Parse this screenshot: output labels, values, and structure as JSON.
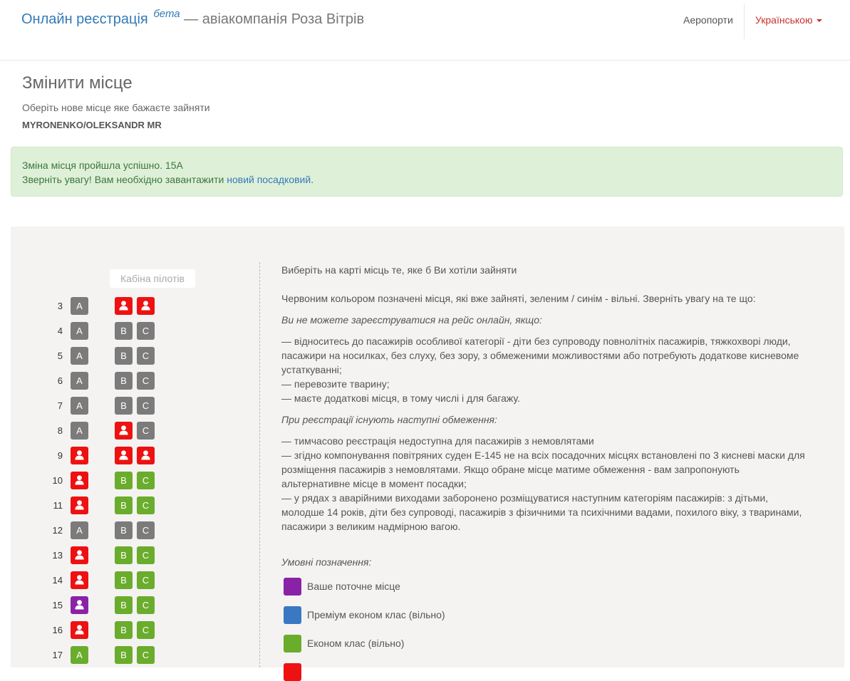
{
  "header": {
    "brand_main": "Онлайн реєстрація",
    "brand_beta": "бета",
    "brand_rest": "— авіакомпанія Роза Вітрів",
    "nav_airports": "Аеропорти",
    "nav_language": "Українською"
  },
  "page": {
    "title": "Змінити місце",
    "subtitle": "Оберіть нове місце яке бажаєте зайняти",
    "passenger": "MYRONENKO/OLEKSANDR MR"
  },
  "alert": {
    "line1": "Зміна місця пройшла успішно. 15A",
    "line2_prefix": "Зверніть увагу! Вам необхідно завантажити ",
    "line2_link": "новий посадковий",
    "line2_suffix": "."
  },
  "seatmap": {
    "cabin_label": "Кабіна пілотів",
    "colors": {
      "gray": "#7b7b7b",
      "green": "#6aac2c",
      "red": "#ee1111",
      "purple": "#8a22a8",
      "blue": "#3a78c3"
    },
    "rows": [
      {
        "row": "3",
        "seats": [
          {
            "letter": "A",
            "status": "unavailable"
          },
          {
            "letter": "B",
            "status": "occupied"
          },
          {
            "letter": "C",
            "status": "occupied"
          }
        ]
      },
      {
        "row": "4",
        "seats": [
          {
            "letter": "A",
            "status": "unavailable"
          },
          {
            "letter": "B",
            "status": "unavailable"
          },
          {
            "letter": "C",
            "status": "unavailable"
          }
        ]
      },
      {
        "row": "5",
        "seats": [
          {
            "letter": "A",
            "status": "unavailable"
          },
          {
            "letter": "B",
            "status": "unavailable"
          },
          {
            "letter": "C",
            "status": "unavailable"
          }
        ]
      },
      {
        "row": "6",
        "seats": [
          {
            "letter": "A",
            "status": "unavailable"
          },
          {
            "letter": "B",
            "status": "unavailable"
          },
          {
            "letter": "C",
            "status": "unavailable"
          }
        ]
      },
      {
        "row": "7",
        "seats": [
          {
            "letter": "A",
            "status": "unavailable"
          },
          {
            "letter": "B",
            "status": "unavailable"
          },
          {
            "letter": "C",
            "status": "unavailable"
          }
        ]
      },
      {
        "row": "8",
        "seats": [
          {
            "letter": "A",
            "status": "unavailable"
          },
          {
            "letter": "B",
            "status": "occupied"
          },
          {
            "letter": "C",
            "status": "unavailable"
          }
        ]
      },
      {
        "row": "9",
        "seats": [
          {
            "letter": "A",
            "status": "occupied"
          },
          {
            "letter": "B",
            "status": "occupied"
          },
          {
            "letter": "C",
            "status": "occupied"
          }
        ]
      },
      {
        "row": "10",
        "seats": [
          {
            "letter": "A",
            "status": "occupied"
          },
          {
            "letter": "B",
            "status": "free"
          },
          {
            "letter": "C",
            "status": "free"
          }
        ]
      },
      {
        "row": "11",
        "seats": [
          {
            "letter": "A",
            "status": "occupied"
          },
          {
            "letter": "B",
            "status": "free"
          },
          {
            "letter": "C",
            "status": "free"
          }
        ]
      },
      {
        "row": "12",
        "seats": [
          {
            "letter": "A",
            "status": "unavailable"
          },
          {
            "letter": "B",
            "status": "unavailable"
          },
          {
            "letter": "C",
            "status": "unavailable"
          }
        ]
      },
      {
        "row": "13",
        "seats": [
          {
            "letter": "A",
            "status": "occupied"
          },
          {
            "letter": "B",
            "status": "free"
          },
          {
            "letter": "C",
            "status": "free"
          }
        ]
      },
      {
        "row": "14",
        "seats": [
          {
            "letter": "A",
            "status": "occupied"
          },
          {
            "letter": "B",
            "status": "free"
          },
          {
            "letter": "C",
            "status": "free"
          }
        ]
      },
      {
        "row": "15",
        "seats": [
          {
            "letter": "A",
            "status": "current"
          },
          {
            "letter": "B",
            "status": "free"
          },
          {
            "letter": "C",
            "status": "free"
          }
        ]
      },
      {
        "row": "16",
        "seats": [
          {
            "letter": "A",
            "status": "occupied"
          },
          {
            "letter": "B",
            "status": "free"
          },
          {
            "letter": "C",
            "status": "free"
          }
        ]
      },
      {
        "row": "17",
        "seats": [
          {
            "letter": "A",
            "status": "free"
          },
          {
            "letter": "B",
            "status": "free"
          },
          {
            "letter": "C",
            "status": "free"
          }
        ]
      }
    ]
  },
  "info": {
    "intro": "Виберіть на карті місць те, яке б Ви хотіли зайняти",
    "color_note": "Червоним кольором позначені місця, які вже зайняті, зеленим / синім - вільні. Зверніть увагу на те що:",
    "cannot_heading": "Ви не можете зареєструватися на рейс онлайн, якщо:",
    "cannot_1a": "— відноситесь до пасажирів особливої категорії - діти без супроводу повнолітніх пасажирів, тяжкохворі люди,",
    "cannot_1b": "пасажири на носилках, без слуху, без зору, з обмеженими можливостями або потребують додаткове кисневоме",
    "cannot_1c": "устаткуванні;",
    "cannot_2": "— перевозите тварину;",
    "cannot_3": "— маєте додаткові місця, в тому числі і для багажу.",
    "limits_heading": "При реєстрації існують наступні обмеження:",
    "limit_1": "— тимчасово реєстрація недоступна для пасажирів з немовлятами",
    "limit_2a": "— згідно компонування повітряних суден Е-145 не на всіх посадочних місцях встановлені по 3 кисневі маски для",
    "limit_2b": "розміщення пасажирів з немовлятами. Якщо обране місце матиме обмеження - вам запропонують",
    "limit_2c": "альтернативне місце в момент посадки;",
    "limit_3a": "— у рядах з аварійними виходами заборонено розміщуватися наступним категоріям пасажирів: з дітьми,",
    "limit_3b": "молодше 14 років, діти без супроводі, пасажирів з фізичними та психічними вадами, похилого віку, з тваринами,",
    "limit_3c": "пасажири з великим надмірною вагою."
  },
  "legend": {
    "title": "Умовні позначення:",
    "items": [
      {
        "label": "Ваше поточне місце",
        "color": "#8a22a8"
      },
      {
        "label": "Преміум економ клас (вільно)",
        "color": "#3a78c3"
      },
      {
        "label": "Економ клас (вільно)",
        "color": "#6aac2c"
      },
      {
        "label": "",
        "color": "#ee1111"
      }
    ]
  }
}
